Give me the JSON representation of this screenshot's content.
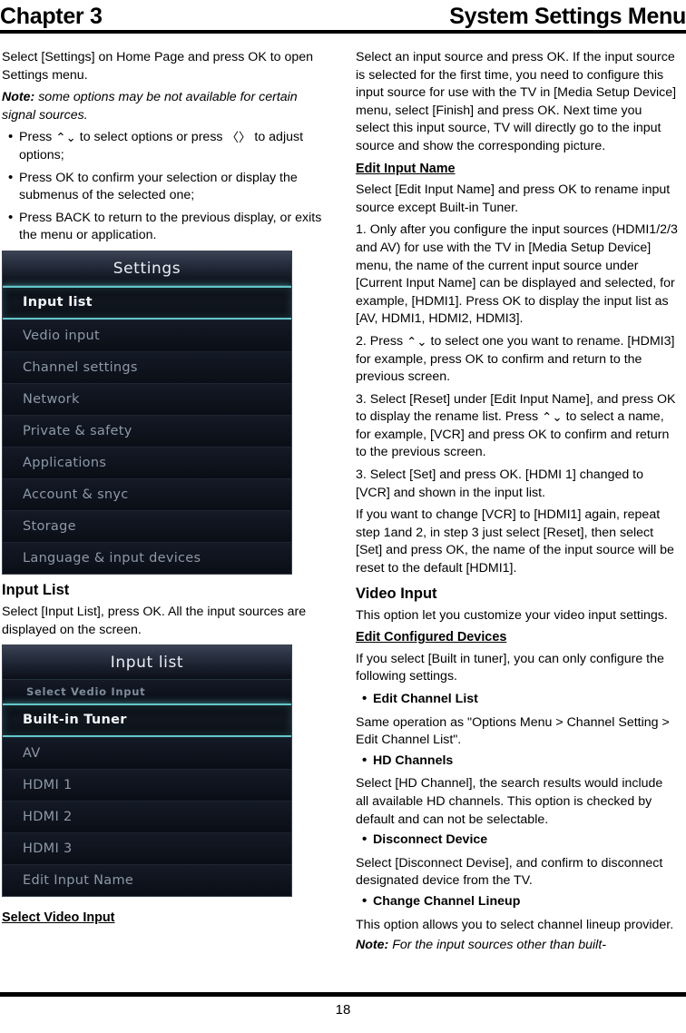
{
  "header": {
    "chapter": "Chapter 3",
    "title": "System Settings Menu"
  },
  "left_column": {
    "intro": "Select [Settings] on Home Page and press OK to open Settings menu.",
    "note_label": "Note:",
    "note_text": " some options may be not available for certain signal sources.",
    "bullets": [
      {
        "pre": "Press ",
        "glyph1": "⌃⌄",
        "mid": " to select options or press ",
        "glyph2": "〈〉",
        "post": " to adjust options;"
      },
      {
        "pre": "Press OK to confirm your selection or display the submenus of the selected one;",
        "glyph1": "",
        "mid": "",
        "glyph2": "",
        "post": ""
      },
      {
        "pre": "Press BACK to return to the previous display, or exits the menu or application.",
        "glyph1": "",
        "mid": "",
        "glyph2": "",
        "post": ""
      }
    ],
    "settings_screenshot": {
      "title": "Settings",
      "items": [
        {
          "label": "Input list",
          "selected": true
        },
        {
          "label": "Vedio input",
          "selected": false
        },
        {
          "label": "Channel settings",
          "selected": false
        },
        {
          "label": "Network",
          "selected": false
        },
        {
          "label": "Private & safety",
          "selected": false
        },
        {
          "label": "Applications",
          "selected": false
        },
        {
          "label": "Account & snyc",
          "selected": false
        },
        {
          "label": "Storage",
          "selected": false
        },
        {
          "label": "Language & input devices",
          "selected": false
        }
      ]
    },
    "input_list_heading": "Input List",
    "input_list_body": "Select [Input List], press OK. All the input sources are displayed on the screen.",
    "inputlist_screenshot": {
      "title": "Input list",
      "sublabel": "Select Vedio Input",
      "items": [
        {
          "label": "Built-in Tuner",
          "selected": true
        },
        {
          "label": "AV",
          "selected": false
        },
        {
          "label": "HDMI 1",
          "selected": false
        },
        {
          "label": "HDMI 2",
          "selected": false
        },
        {
          "label": "HDMI 3",
          "selected": false
        },
        {
          "label": "Edit Input Name",
          "selected": false
        }
      ]
    },
    "select_video_input_heading": "Select Video Input"
  },
  "right_column": {
    "para1": "Select an input source and press OK. If the input source is selected for the first time, you need to configure this input source for use with the TV in [Media Setup Device] menu, select [Finish] and press OK. Next time you select this input source, TV will directly go to the input source and show the corresponding picture.",
    "edit_input_name_heading": "Edit Input Name",
    "para2": "Select [Edit Input Name] and press OK to rename input source except Built-in Tuner.",
    "step1": "1. Only after you configure the input sources (HDMI1/2/3 and AV) for use with the TV in [Media Setup Device] menu, the name of the current input source under [Current Input Name] can be displayed and selected, for example, [HDMI1]. Press OK to display the input list as [AV, HDMI1, HDMI2, HDMI3].",
    "step2_pre": "2. Press  ",
    "step2_glyph": "⌃⌄",
    "step2_post": " to select one you want to rename. [HDMI3] for example, press OK to confirm and return to the previous screen.",
    "step3a_pre": "3. Select [Reset] under [Edit Input Name], and press OK to display the rename list. Press  ",
    "step3a_glyph": "⌃⌄",
    "step3a_post": "  to select a name, for example, [VCR] and press OK to confirm and return to the previous screen.",
    "step3b": "3. Select [Set] and press OK. [HDMI 1] changed to [VCR] and shown in the input list.",
    "para3": "If you want to change [VCR] to [HDMI1] again, repeat step 1and 2, in step 3 just select [Reset], then select [Set] and press OK, the name of the input source will be reset to the default [HDMI1].",
    "video_input_heading": "Video Input",
    "video_input_body": "This option let you customize your video input settings.",
    "edit_configured_devices_heading": "Edit Configured Devices",
    "edit_configured_devices_body": "If you select [Built in tuner], you can only configure the following settings.",
    "options": [
      {
        "title": "Edit Channel List",
        "body": "Same operation as \"Options Menu > Channel Setting > Edit Channel List\"."
      },
      {
        "title": "HD Channels",
        "body": "Select [HD Channel], the search results would include all available HD channels. This option is checked by default and can not be selectable."
      },
      {
        "title": "Disconnect Device",
        "body": "Select [Disconnect Devise], and confirm to disconnect designated device from the TV."
      },
      {
        "title": "Change Channel Lineup",
        "body": "This option allows you to select channel lineup provider."
      }
    ],
    "note_label": "Note:",
    "note_text": " For the input sources other than built-"
  },
  "footer": {
    "page_number": "18"
  },
  "colors": {
    "highlight_cyan": "#63c6c9",
    "menu_text": "#8d99a8",
    "menu_bg": "#0e131d"
  }
}
